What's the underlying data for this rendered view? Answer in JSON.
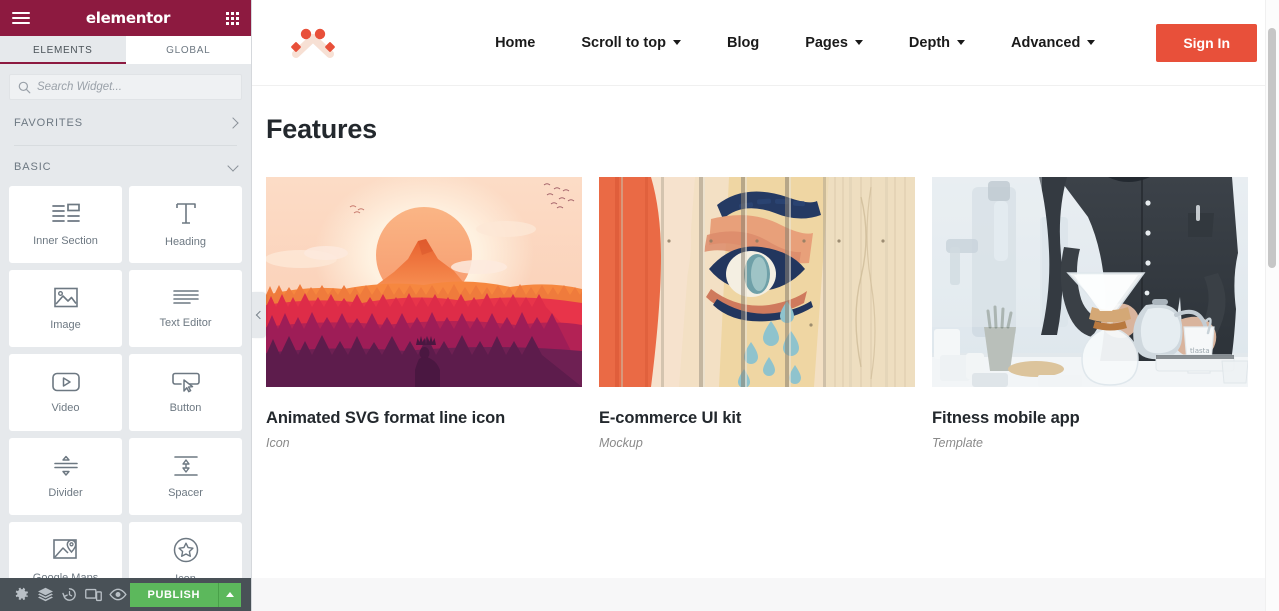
{
  "editor": {
    "brand": "elementor",
    "menu_icon": "hamburger-icon",
    "apps_icon": "grid-apps-icon",
    "tabs": [
      {
        "label": "ELEMENTS",
        "active": true
      },
      {
        "label": "GLOBAL",
        "active": false
      }
    ],
    "search": {
      "placeholder": "Search Widget...",
      "value": "",
      "icon": "search-icon"
    },
    "sections": [
      {
        "label": "FAVORITES",
        "state": "collapsed",
        "chevron": "chevron-right-icon"
      },
      {
        "label": "BASIC",
        "state": "expanded",
        "chevron": "chevron-down-icon"
      }
    ],
    "widgets": [
      {
        "label": "Inner Section",
        "icon": "inner-section-icon"
      },
      {
        "label": "Heading",
        "icon": "heading-t-icon"
      },
      {
        "label": "Image",
        "icon": "image-icon"
      },
      {
        "label": "Text Editor",
        "icon": "text-editor-icon"
      },
      {
        "label": "Video",
        "icon": "video-play-icon"
      },
      {
        "label": "Button",
        "icon": "button-cursor-icon"
      },
      {
        "label": "Divider",
        "icon": "divider-icon"
      },
      {
        "label": "Spacer",
        "icon": "spacer-icon"
      },
      {
        "label": "Google Maps",
        "icon": "google-maps-icon"
      },
      {
        "label": "Icon",
        "icon": "star-circle-icon"
      }
    ],
    "footer": {
      "buttons": [
        {
          "name": "settings",
          "icon": "gear-icon"
        },
        {
          "name": "navigator",
          "icon": "layers-icon"
        },
        {
          "name": "history",
          "icon": "history-clock-icon"
        },
        {
          "name": "responsive-mode",
          "icon": "devices-icon"
        },
        {
          "name": "preview-changes",
          "icon": "eye-icon"
        }
      ],
      "publish_label": "PUBLISH",
      "publish_caret_icon": "caret-up-icon",
      "publish_color": "#5cb85c"
    },
    "collapse_handle": {
      "icon": "chevron-left-icon"
    },
    "colors": {
      "header_bg": "#8d1a40",
      "panel_bg": "#e6e9ec",
      "footer_bg": "#495157",
      "accent": "#8d1a40"
    }
  },
  "site": {
    "logo": {
      "icon": "three-dots-chevron-logo",
      "color_primary": "#e8503a",
      "color_secondary": "#f7e3d8"
    },
    "nav": [
      {
        "label": "Home",
        "has_dropdown": false
      },
      {
        "label": "Scroll to top",
        "has_dropdown": true
      },
      {
        "label": "Blog",
        "has_dropdown": false
      },
      {
        "label": "Pages",
        "has_dropdown": true
      },
      {
        "label": "Depth",
        "has_dropdown": true
      },
      {
        "label": "Advanced",
        "has_dropdown": true
      }
    ],
    "cta": {
      "label": "Sign In",
      "color": "#e8503a"
    },
    "page_title": "Features",
    "cards": [
      {
        "title": "Animated SVG format line icon",
        "subtitle": "Icon",
        "image": "sunset-mountain-forest-illustration"
      },
      {
        "title": "E-commerce UI kit",
        "subtitle": "Mockup",
        "image": "street-art-eye-mural-on-wood-fence"
      },
      {
        "title": "Fitness mobile app",
        "subtitle": "Template",
        "image": "barista-pouring-coffee-photo"
      }
    ]
  }
}
